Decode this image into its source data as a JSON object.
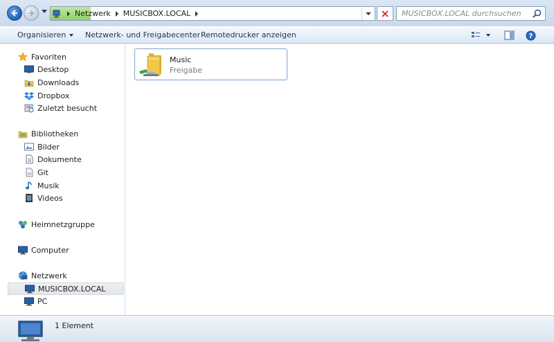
{
  "address_bar": {
    "breadcrumbs": [
      "Netzwerk",
      "MUSICBOX.LOCAL"
    ],
    "search_placeholder": "MUSICBOX.LOCAL durchsuchen"
  },
  "command_bar": {
    "organize": "Organisieren",
    "network_center": "Netzwerk- und Freigabecenter",
    "remote_printers": "Remotedrucker anzeigen"
  },
  "nav_pane": {
    "favorites": {
      "label": "Favoriten",
      "items": [
        "Desktop",
        "Downloads",
        "Dropbox",
        "Zuletzt besucht"
      ]
    },
    "libraries": {
      "label": "Bibliotheken",
      "items": [
        "Bilder",
        "Dokumente",
        "Git",
        "Musik",
        "Videos"
      ]
    },
    "homegroup": "Heimnetzgruppe",
    "computer": "Computer",
    "network": {
      "label": "Netzwerk",
      "items": [
        "MUSICBOX.LOCAL",
        "PC"
      ],
      "selected": "MUSICBOX.LOCAL"
    }
  },
  "content": {
    "items": [
      {
        "name": "Music",
        "type": "Freigabe"
      }
    ]
  },
  "status_bar": {
    "count": "1 Element"
  },
  "colors": {
    "accent": "#1c5fb6",
    "address_progress": "#8fd16a",
    "stop_red": "#d02a2a",
    "folder_yellow": "#f1c84b"
  },
  "icons": {
    "back": "back-arrow-icon",
    "forward": "forward-arrow-icon",
    "stop": "close-icon",
    "search": "search-icon",
    "view": "view-options-icon",
    "preview": "preview-pane-icon",
    "help": "help-icon"
  }
}
